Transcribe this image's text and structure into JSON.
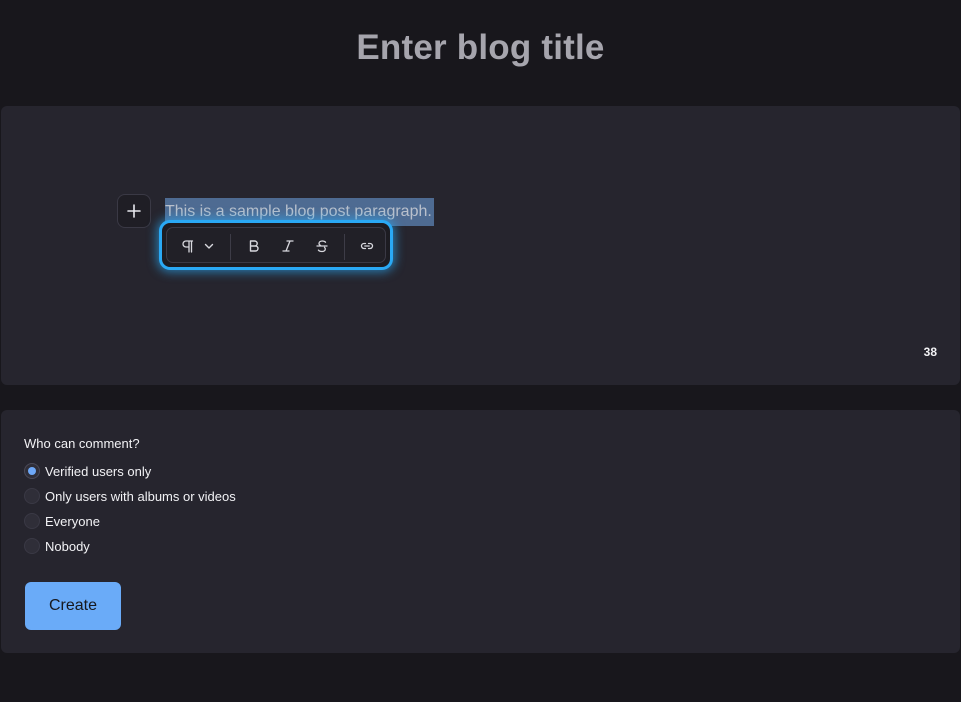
{
  "title": "Enter blog title",
  "editor": {
    "paragraph_text": "This is a sample blog post paragraph.",
    "char_count": "38",
    "add_block_icon": "plus-icon"
  },
  "toolbar": {
    "block_type_icon": "pilcrow-icon",
    "block_type_dropdown_icon": "chevron-down-icon",
    "bold_icon": "bold-icon",
    "italic_icon": "italic-icon",
    "strikethrough_icon": "strikethrough-icon",
    "link_icon": "link-icon",
    "accent_color": "#2aa9f5"
  },
  "comments": {
    "question": "Who can comment?",
    "options": [
      {
        "label": "Verified users only",
        "checked": true
      },
      {
        "label": "Only users with albums or videos",
        "checked": false
      },
      {
        "label": "Everyone",
        "checked": false
      },
      {
        "label": "Nobody",
        "checked": false
      }
    ]
  },
  "create_button": {
    "label": "Create",
    "color": "#6aabf8"
  }
}
